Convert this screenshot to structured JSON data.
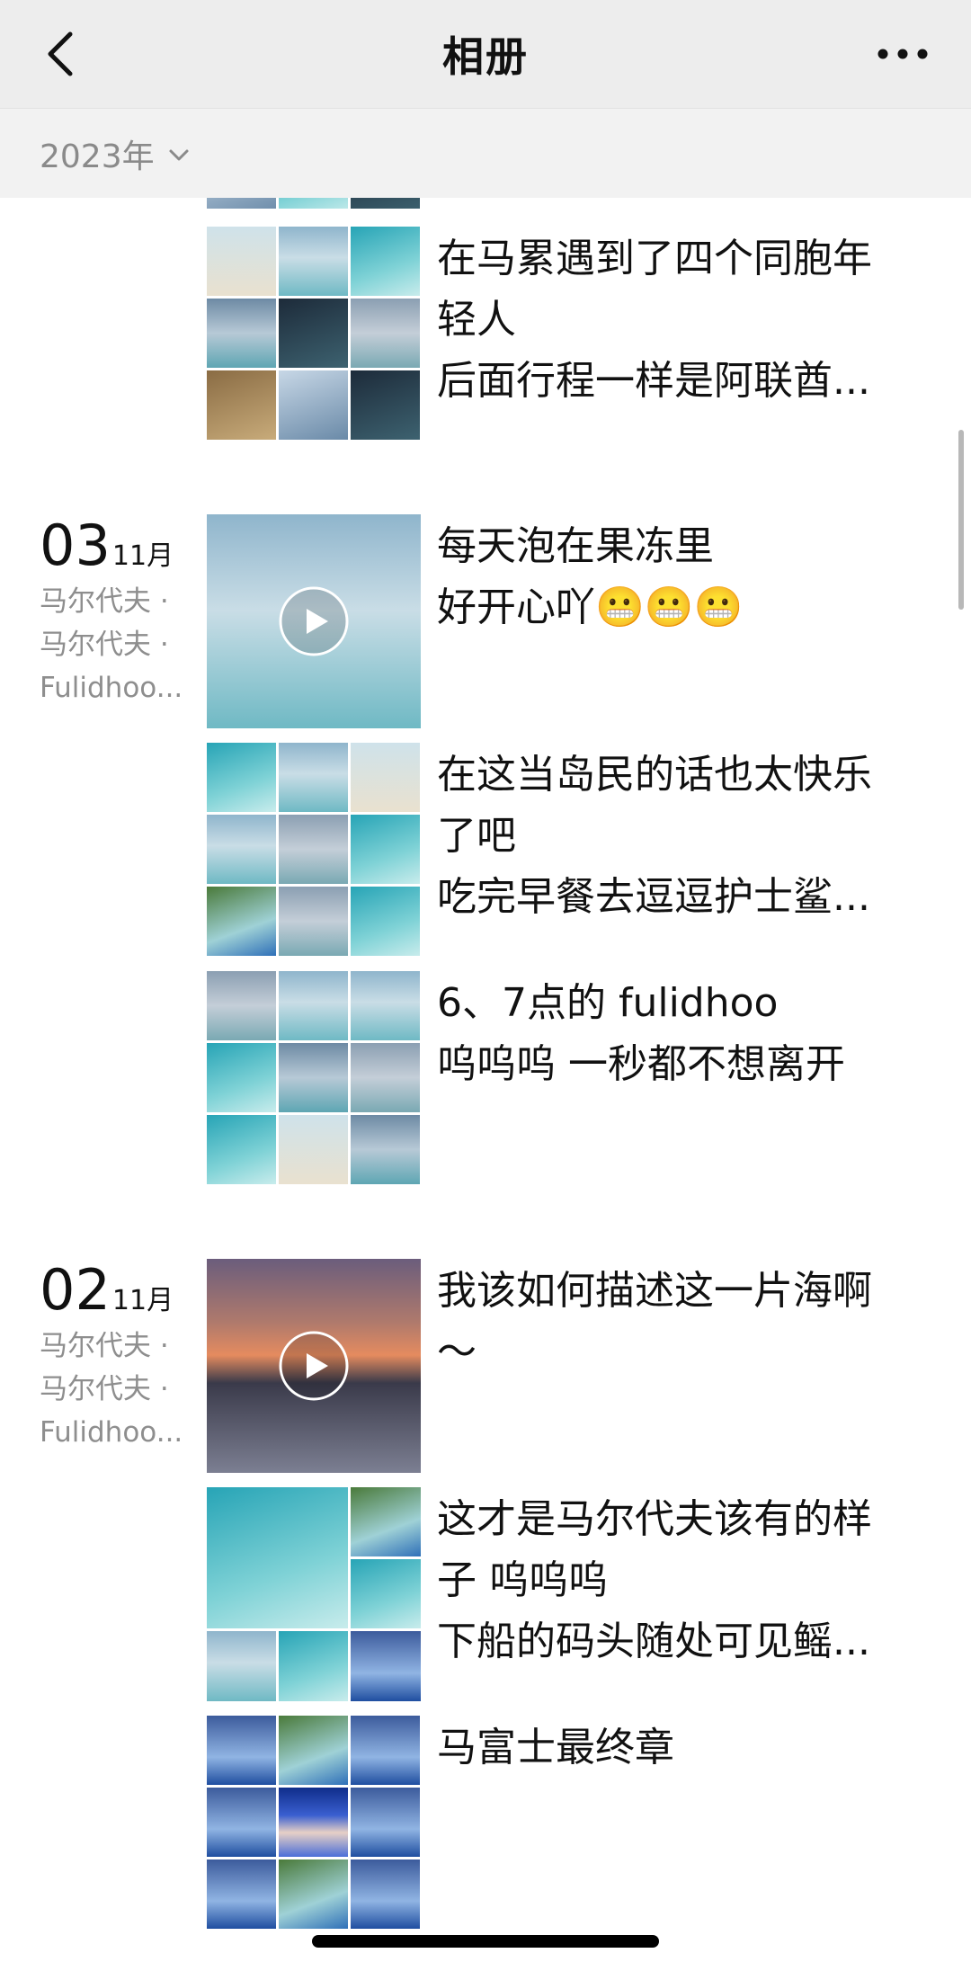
{
  "nav": {
    "title": "相册",
    "back_icon": "chevron-left-icon",
    "more_icon": "more-dots-icon"
  },
  "yearbar": {
    "year": "2023年",
    "icon": "chevron-down-icon"
  },
  "groups": [
    {
      "posts": [
        {
          "lines": [
            "在马累遇到了四个同胞年",
            "轻人",
            "后面行程一样是阿联酋..."
          ],
          "thumb": "grid9",
          "shared": true
        }
      ]
    },
    {
      "day": "03",
      "month": "11月",
      "location": [
        "马尔代夫 ·",
        "马尔代夫 ·",
        "Fulidhoo..."
      ],
      "posts": [
        {
          "lines": [
            "每天泡在果冻里",
            "好开心吖😬😬😬"
          ],
          "thumb": "video",
          "shared": true
        },
        {
          "lines": [
            "在这当岛民的话也太快乐",
            "了吧",
            "吃完早餐去逗逗护士鲨..."
          ],
          "thumb": "grid9",
          "shared": true
        },
        {
          "lines": [
            "6、7点的 fulidhoo",
            "呜呜呜 一秒都不想离开"
          ],
          "thumb": "grid9",
          "shared": true
        }
      ]
    },
    {
      "day": "02",
      "month": "11月",
      "location": [
        "马尔代夫 ·",
        "马尔代夫 ·",
        "Fulidhoo..."
      ],
      "posts": [
        {
          "lines": [
            "我该如何描述这一片海啊",
            "～"
          ],
          "thumb": "video",
          "shared": true
        },
        {
          "lines": [
            "这才是马尔代夫该有的样",
            "子 呜呜呜",
            "下船的码头随处可见鳐..."
          ],
          "thumb": "grid4",
          "shared": true
        },
        {
          "lines": [
            "马富士最终章"
          ],
          "thumb": "grid9",
          "shared": true
        }
      ]
    }
  ]
}
